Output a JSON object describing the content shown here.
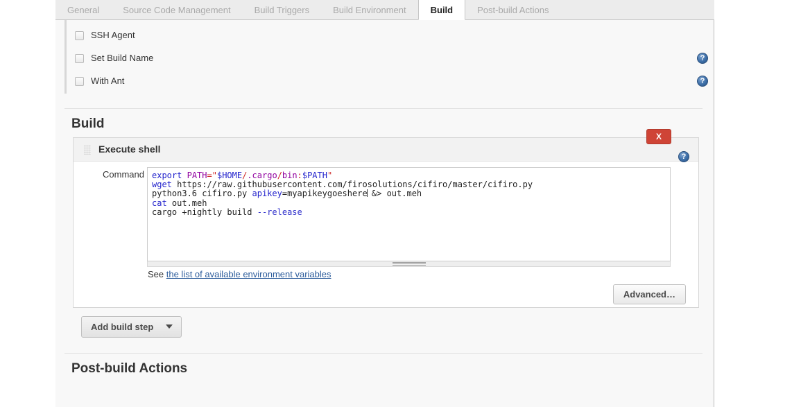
{
  "tabs": [
    {
      "label": "General",
      "active": false
    },
    {
      "label": "Source Code Management",
      "active": false
    },
    {
      "label": "Build Triggers",
      "active": false
    },
    {
      "label": "Build Environment",
      "active": false
    },
    {
      "label": "Build",
      "active": true
    },
    {
      "label": "Post-build Actions",
      "active": false
    }
  ],
  "build_environment": {
    "checkboxes": [
      {
        "label": "SSH Agent",
        "checked": false,
        "help": false
      },
      {
        "label": "Set Build Name",
        "checked": false,
        "help": true
      },
      {
        "label": "With Ant",
        "checked": false,
        "help": true
      }
    ]
  },
  "build_section": {
    "title": "Build",
    "step": {
      "title": "Execute shell",
      "close_label": "X",
      "command_label": "Command",
      "command_value": "export PATH=\"$HOME/.cargo/bin:$PATH\"\nwget https://raw.githubusercontent.com/firosolutions/cifiro/master/cifiro.py\npython3.6 cifiro.py apikey=myapikeygoeshere &> out.meh\ncat out.meh\ncargo +nightly build --release",
      "command_lines": [
        [
          {
            "t": "export",
            "c": "kw"
          },
          {
            "t": " ",
            "c": "plain"
          },
          {
            "t": "PATH",
            "c": "var"
          },
          {
            "t": "=",
            "c": "str"
          },
          {
            "t": "\"",
            "c": "str"
          },
          {
            "t": "$HOME",
            "c": "svar"
          },
          {
            "t": "/",
            "c": "str"
          },
          {
            "t": ".cargo",
            "c": "var"
          },
          {
            "t": "/",
            "c": "str"
          },
          {
            "t": "bin",
            "c": "var"
          },
          {
            "t": ":",
            "c": "str"
          },
          {
            "t": "$PATH",
            "c": "svar"
          },
          {
            "t": "\"",
            "c": "str"
          }
        ],
        [
          {
            "t": "wget",
            "c": "kw"
          },
          {
            "t": " https://raw.githubusercontent.com/firosolutions/cifiro/master/cifiro.py",
            "c": "plain"
          }
        ],
        [
          {
            "t": "python3.6 cifiro.py ",
            "c": "plain"
          },
          {
            "t": "apikey",
            "c": "kw"
          },
          {
            "t": "=myapikeygoeshere",
            "c": "plain"
          },
          {
            "t": "__CARET__",
            "c": "caret"
          },
          {
            "t": " &> out.meh",
            "c": "plain"
          }
        ],
        [
          {
            "t": "cat",
            "c": "kw"
          },
          {
            "t": " out.meh",
            "c": "plain"
          }
        ],
        [
          {
            "t": "cargo +nightly build ",
            "c": "plain"
          },
          {
            "t": "--release",
            "c": "flag"
          }
        ]
      ],
      "see_prefix": "See ",
      "see_link": "the list of available environment variables",
      "advanced_label": "Advanced…"
    },
    "add_build_step_label": "Add build step"
  },
  "post_build_section": {
    "title": "Post-build Actions"
  },
  "colors": {
    "accent_link": "#2c5c9b",
    "danger": "#cf4436",
    "help_icon": "#3d6fa8",
    "panel_bg": "#f8f8f8",
    "tab_inactive_text": "#a9a9a9"
  },
  "icons": {
    "help": "help-icon",
    "grip": "drag-handle-icon",
    "dropdown": "chevron-down-icon",
    "resize": "resize-grip-icon"
  }
}
